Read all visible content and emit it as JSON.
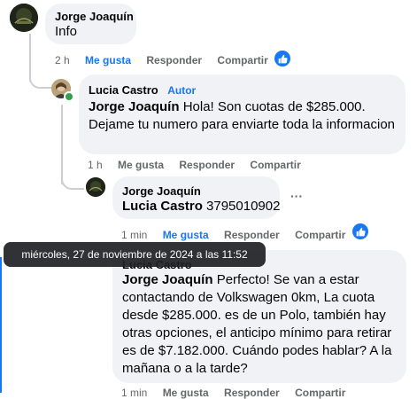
{
  "comments": [
    {
      "author": "Jorge Joaquín",
      "text": "Info",
      "time": "2 h",
      "like": "Me gusta",
      "reply": "Responder",
      "share": "Compartir"
    },
    {
      "author": "Lucia Castro",
      "badge": "Autor",
      "mention": "Jorge Joaquín",
      "text": " Hola! Son cuotas de $285.000. Dejame tu numero para enviarte toda la informacion",
      "time": "1 h",
      "like": "Me gusta",
      "reply": "Responder",
      "share": "Compartir"
    },
    {
      "author": "Jorge Joaquín",
      "mention": "Lucia Castro",
      "text": " 3795010902",
      "more": "···",
      "time": "1 min",
      "like": "Me gusta",
      "reply": "Responder",
      "share": "Compartir"
    },
    {
      "author": "Lucia Castro",
      "mention": "Jorge Joaquín",
      "text": " Perfecto! Se van a estar contactando de Volkswagen 0km, La cuota desde $285.000. es de un Polo, también hay otras opciones, el anticipo mínimo para retirar es de $7.182.000. Cuándo podes hablar? A la mañana o a la tarde?",
      "time": "1 min",
      "like": "Me gusta",
      "reply": "Responder",
      "share": "Compartir"
    }
  ],
  "tooltip": "miércoles, 27 de noviembre de 2024 a las 11:52",
  "colors": {
    "accent": "#1877f2",
    "bubble": "#f0f2f5",
    "muted": "#65676b"
  }
}
